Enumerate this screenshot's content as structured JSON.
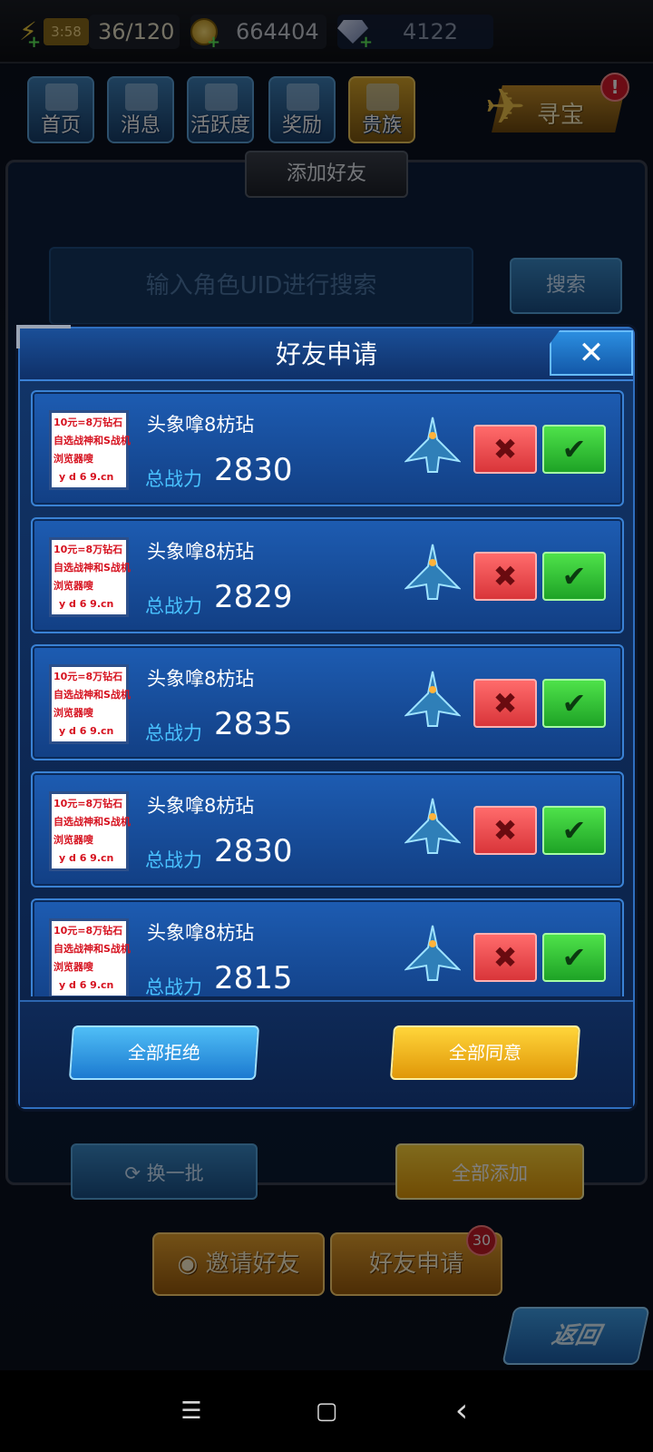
{
  "topbar": {
    "timer": "3:58",
    "energy": "36/120",
    "coins": "664404",
    "gems": "4122"
  },
  "nav": [
    {
      "label": "首页"
    },
    {
      "label": "消息"
    },
    {
      "label": "活跃度"
    },
    {
      "label": "奖励"
    },
    {
      "label": "贵族"
    }
  ],
  "treasure": {
    "label": "寻宝",
    "alert": "!"
  },
  "add_friend": {
    "title": "添加好友",
    "search_placeholder": "输入角色UID进行搜索",
    "search_button": "搜索",
    "refresh_button": "换一批",
    "add_all_button": "全部添加",
    "invite_tab": "邀请好友",
    "requests_tab": "好友申请",
    "requests_badge": "30",
    "back_button": "返回"
  },
  "modal": {
    "title": "好友申请",
    "close": "✕",
    "power_label": "总战力",
    "reject_symbol": "✖",
    "accept_symbol": "✔",
    "avatar_ad_lines": [
      "10元=8万钻石",
      "自选战神和S战机",
      "浏览器嗖",
      "y d 6 9.cn"
    ],
    "requests": [
      {
        "name": "头象嗱8枋玷",
        "power": "2830"
      },
      {
        "name": "头象嗱8枋玷",
        "power": "2829"
      },
      {
        "name": "头象嗱8枋玷",
        "power": "2835"
      },
      {
        "name": "头象嗱8枋玷",
        "power": "2830"
      },
      {
        "name": "头象嗱8枋玷",
        "power": "2815"
      }
    ],
    "reject_all": "全部拒绝",
    "accept_all": "全部同意"
  },
  "system_nav": {
    "menu": "☰",
    "home": "▢",
    "back": "‹"
  },
  "colors": {
    "accept": "#1ea326",
    "reject": "#d9353a",
    "power_label": "#49c2ff",
    "accept_all": "#e09708",
    "reject_all": "#1c7ad0"
  }
}
